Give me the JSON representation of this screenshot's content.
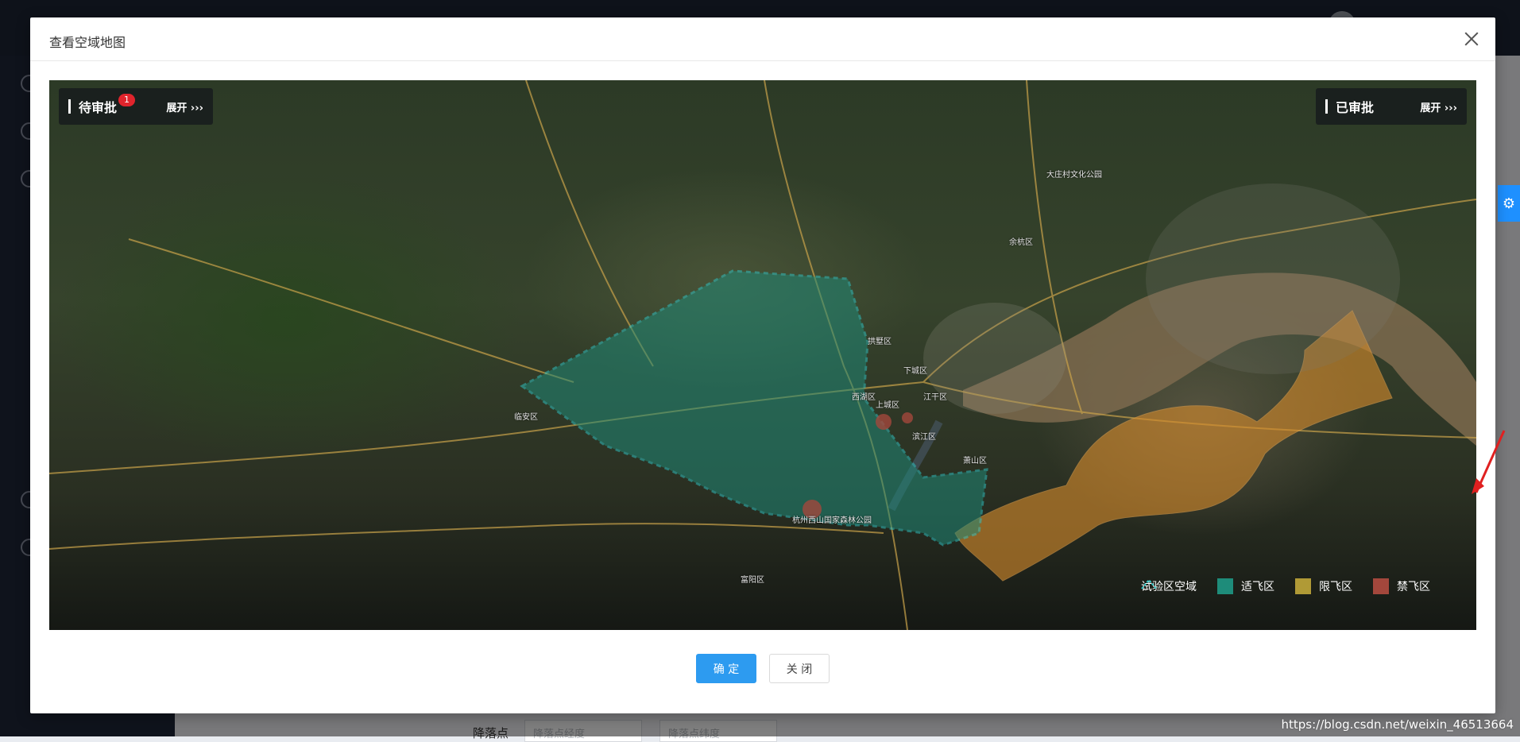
{
  "modal": {
    "title": "查看空域地图",
    "close_label": "×"
  },
  "map": {
    "pending_panel": {
      "title": "待审批",
      "badge": "1",
      "expand": "展开 ›››"
    },
    "approved_panel": {
      "title": "已审批",
      "expand": "展开 ›››"
    },
    "legend": [
      {
        "label": "试验区空域",
        "color": "#2ec4c4"
      },
      {
        "label": "适飞区",
        "color": "#1e8c7a"
      },
      {
        "label": "限飞区",
        "color": "#b09a36"
      },
      {
        "label": "禁飞区",
        "color": "#a3473c"
      }
    ],
    "place_labels": [
      "余杭区",
      "拱墅区",
      "下城区",
      "西湖区",
      "上城区",
      "江干区",
      "滨江区",
      "萧山区",
      "富阳区",
      "临安区",
      "杭州西山国家森林公园",
      "大庄村文化公园"
    ]
  },
  "footer": {
    "confirm": "确 定",
    "close": "关 闭"
  },
  "background": {
    "form_label": "降落点",
    "input1_placeholder": "降落点经度",
    "input2_placeholder": "降落点纬度"
  },
  "watermark": "https://blog.csdn.net/weixin_46513664"
}
